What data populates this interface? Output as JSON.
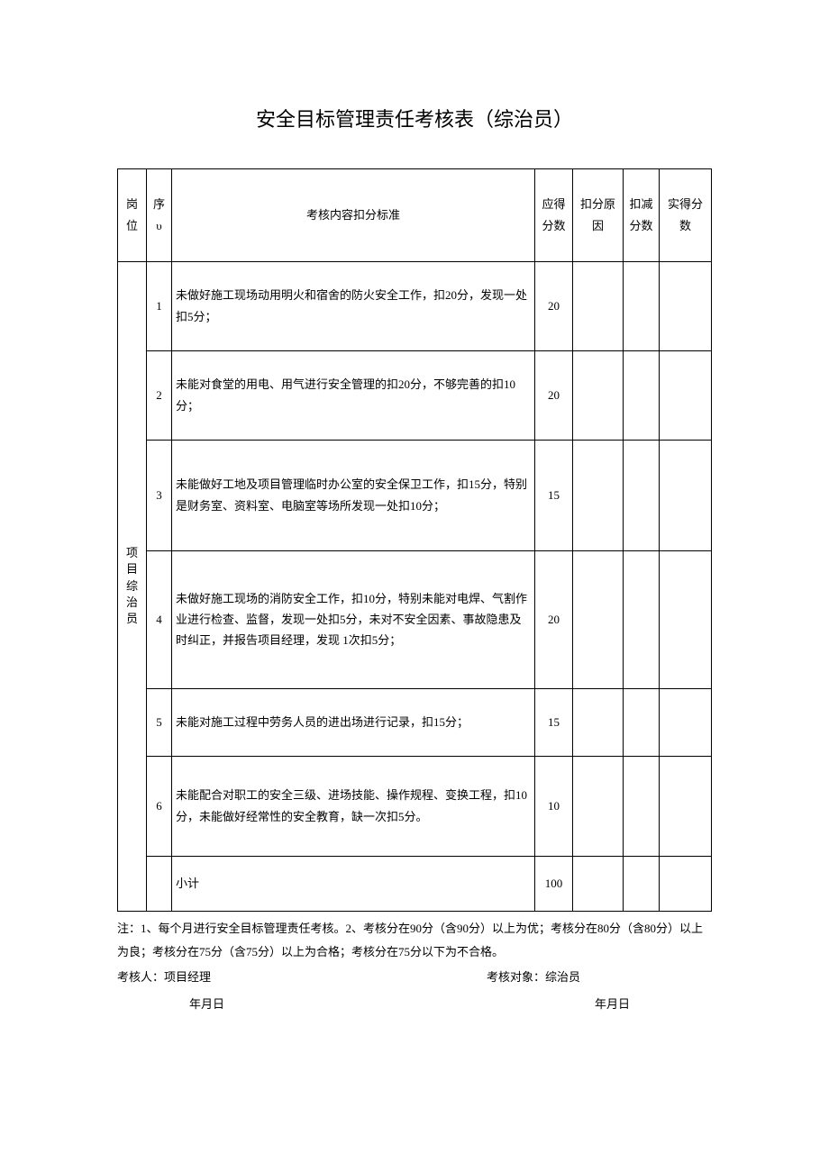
{
  "title": "安全目标管理责任考核表（综治员）",
  "columns": {
    "position": "岗位",
    "seq": "序\nυ",
    "content": "考核内容扣分标准",
    "score": "应得分数",
    "reason": "扣分原因",
    "deduct": "扣减分数",
    "actual": "实得分数"
  },
  "positionLabel": "项目综治员",
  "rows": [
    {
      "seq": "1",
      "content": "未做好施工现场动用明火和宿舍的防火安全工作，扣20分，发现一处扣5分；",
      "score": "20"
    },
    {
      "seq": "2",
      "content": "未能对食堂的用电、用气进行安全管理的扣20分，不够完善的扣10分；",
      "score": "20"
    },
    {
      "seq": "3",
      "content": "未能做好工地及项目管理临时办公室的安全保卫工作，扣15分，特别是财务室、资料室、电脑室等场所发现一处扣10分；",
      "score": "15"
    },
    {
      "seq": "4",
      "content": "未做好施工现场的消防安全工作，扣10分，特别未能对电焊、气割作业进行检查、监督，发现一处扣5分，未对不安全因素、事故隐患及时纠正，并报告项目经理，发现 1次扣5分；",
      "score": "20"
    },
    {
      "seq": "5",
      "content": "未能对施工过程中劳务人员的进出场进行记录，扣15分；",
      "score": "15"
    },
    {
      "seq": "6",
      "content": "未能配合对职工的安全三级、进场技能、操作规程、变换工程，扣10分，未能做好经常性的安全教育，缺一次扣5分。",
      "score": "10"
    }
  ],
  "subtotal": {
    "label": "小计",
    "score": "100"
  },
  "notes": "注：1、每个月进行安全目标管理责任考核。2、考核分在90分（含90分）以上为优；考核分在80分（含80分）以上为良；考核分在75分（含75分）以上为合格；考核分在75分以下为不合格。",
  "examiner": "考核人：项目经理",
  "examinee": "考核对象：综治员",
  "dateLeft": "年月日",
  "dateRight": "年月日"
}
